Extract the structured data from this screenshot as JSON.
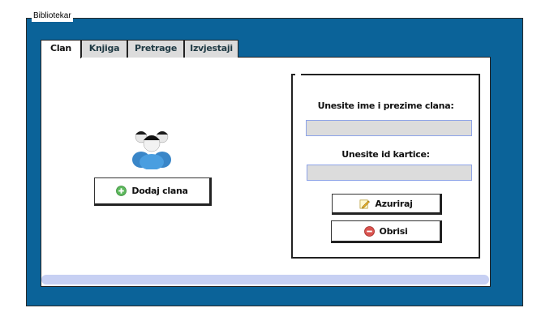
{
  "window": {
    "title": "Bibliotekar"
  },
  "tabs": [
    {
      "label": "Clan",
      "active": true
    },
    {
      "label": "Knjiga",
      "active": false
    },
    {
      "label": "Pretrage",
      "active": false
    },
    {
      "label": "Izvjestaji",
      "active": false
    }
  ],
  "member": {
    "add_button_label": "Dodaj clana",
    "users_icon": "users-icon"
  },
  "form": {
    "name_label": "Unesite ime i prezime clana:",
    "name_value": "",
    "card_label": "Unesite id kartice:",
    "card_value": "",
    "update_label": "Azuriraj",
    "delete_label": "Obrisi"
  },
  "colors": {
    "window_bg": "#0b6399",
    "field_bg": "#dcdcdc",
    "field_border": "#8da3e8",
    "add_icon": "#5cb85c",
    "delete_icon": "#d9534f"
  }
}
